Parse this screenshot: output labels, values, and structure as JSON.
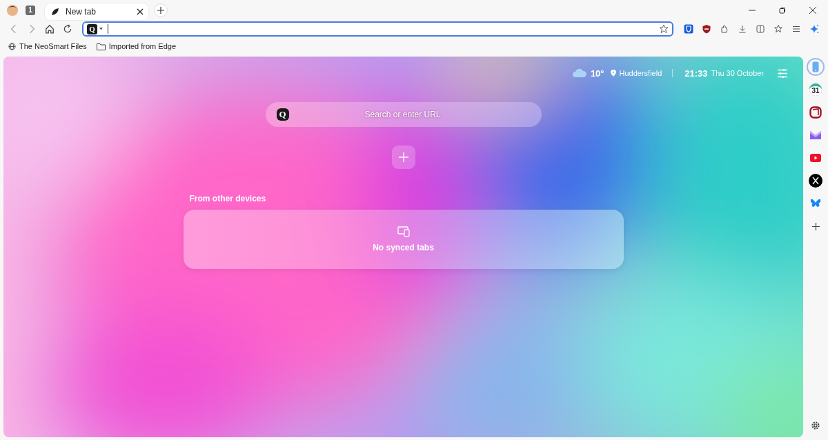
{
  "tab_strip": {
    "tab_count": "1",
    "tabs": [
      {
        "title": "New tab",
        "selected": true
      }
    ]
  },
  "address_bar": {
    "engine_logo": "Q"
  },
  "bookmarks": [
    {
      "kind": "site",
      "label": "The NeoSmart Files"
    },
    {
      "kind": "folder",
      "label": "Imported from Edge"
    }
  ],
  "new_tab_page": {
    "weather": {
      "temperature": "10°",
      "location": "Huddersfield"
    },
    "time": "21:33",
    "date": "Thu 30 October",
    "search": {
      "logo": "Q",
      "placeholder": "Search or enter URL"
    },
    "synced": {
      "heading": "From other devices",
      "message": "No synced tabs"
    }
  },
  "sidebar": {
    "items": [
      {
        "kind": "phone",
        "selected": true
      },
      {
        "kind": "calendar",
        "label": "31",
        "selected": false
      },
      {
        "kind": "notes",
        "selected": false
      },
      {
        "kind": "mail",
        "selected": false
      },
      {
        "kind": "video",
        "selected": false
      },
      {
        "kind": "x",
        "selected": false
      },
      {
        "kind": "butterfly",
        "selected": false
      }
    ]
  }
}
